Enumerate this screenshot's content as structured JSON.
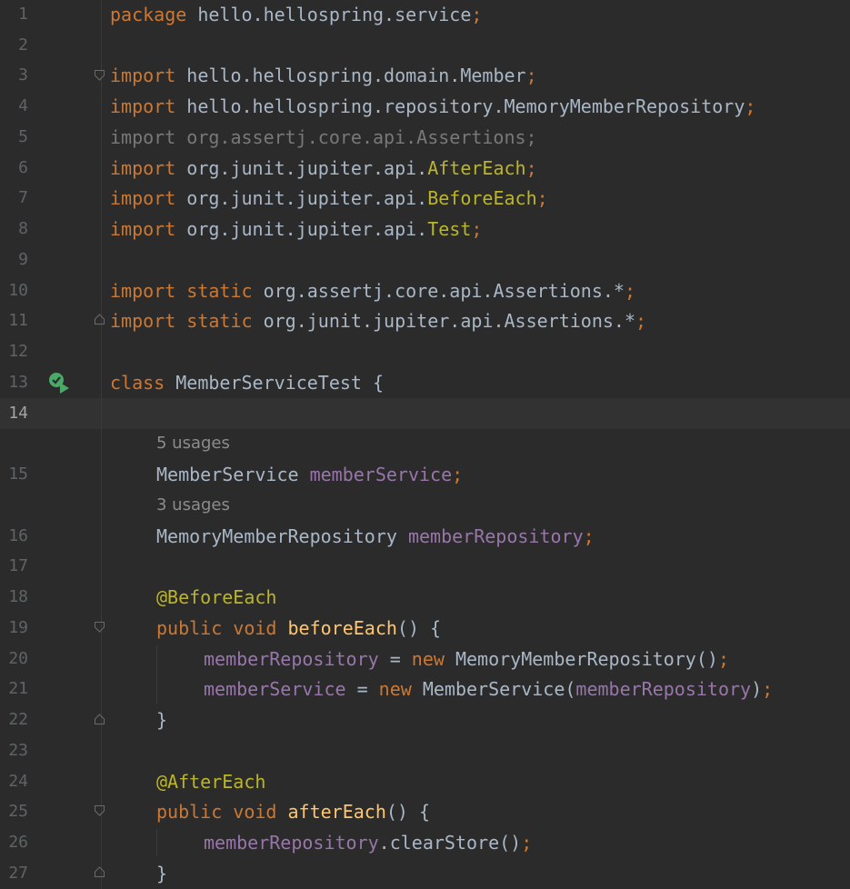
{
  "lines": {
    "l1": {
      "num": "1",
      "kw": "package",
      "pkg": "hello.hellospring.service",
      "semi": ";"
    },
    "l2": {
      "num": "2"
    },
    "l3": {
      "num": "3",
      "kw": "import",
      "path": "hello.hellospring.domain.Member",
      "semi": ";"
    },
    "l4": {
      "num": "4",
      "kw": "import",
      "path": "hello.hellospring.repository.MemoryMemberRepository",
      "semi": ";"
    },
    "l5": {
      "num": "5",
      "text": "import org.assertj.core.api.Assertions;"
    },
    "l6": {
      "num": "6",
      "kw": "import",
      "path": "org.junit.jupiter.api.",
      "cls": "AfterEach",
      "semi": ";"
    },
    "l7": {
      "num": "7",
      "kw": "import",
      "path": "org.junit.jupiter.api.",
      "cls": "BeforeEach",
      "semi": ";"
    },
    "l8": {
      "num": "8",
      "kw": "import",
      "path": "org.junit.jupiter.api.",
      "cls": "Test",
      "semi": ";"
    },
    "l9": {
      "num": "9"
    },
    "l10": {
      "num": "10",
      "kw": "import static",
      "path": "org.assertj.core.api.Assertions.*",
      "semi": ";"
    },
    "l11": {
      "num": "11",
      "kw": "import static",
      "path": "org.junit.jupiter.api.Assertions.*",
      "semi": ";"
    },
    "l12": {
      "num": "12"
    },
    "l13": {
      "num": "13",
      "kw": "class",
      "name": "MemberServiceTest {"
    },
    "l14": {
      "num": "14"
    },
    "hint15": "5 usages",
    "l15": {
      "num": "15",
      "type": "MemberService",
      "field": "memberService",
      "semi": ";"
    },
    "hint16": "3 usages",
    "l16": {
      "num": "16",
      "type": "MemoryMemberRepository",
      "field": "memberRepository",
      "semi": ";"
    },
    "l17": {
      "num": "17"
    },
    "l18": {
      "num": "18",
      "annotation": "@BeforeEach"
    },
    "l19": {
      "num": "19",
      "kw": "public void",
      "method": "beforeEach",
      "rest": "() {"
    },
    "l20": {
      "num": "20",
      "field": "memberRepository",
      "op": " = ",
      "kw": "new",
      "call": " MemoryMemberRepository()",
      "semi": ";"
    },
    "l21": {
      "num": "21",
      "field": "memberService",
      "op": " = ",
      "kw": "new",
      "call": " MemberService(",
      "arg": "memberRepository",
      "close": ")",
      "semi": ";"
    },
    "l22": {
      "num": "22",
      "text": "}"
    },
    "l23": {
      "num": "23"
    },
    "l24": {
      "num": "24",
      "annotation": "@AfterEach"
    },
    "l25": {
      "num": "25",
      "kw": "public void",
      "method": "afterEach",
      "rest": "() {"
    },
    "l26": {
      "num": "26",
      "field": "memberRepository",
      "call": ".clearStore()",
      "semi": ";"
    },
    "l27": {
      "num": "27",
      "text": "}"
    }
  },
  "icons": {
    "run": "run-test-icon",
    "fold": "fold-marker-icon"
  },
  "colors": {
    "background": "#2b2b2b",
    "keyword": "#cc7832",
    "field": "#9876aa",
    "method": "#ffc66d",
    "annotation": "#bbb529",
    "text": "#a9b7c6",
    "unused": "#787878",
    "run_icon": "#4aa868"
  }
}
